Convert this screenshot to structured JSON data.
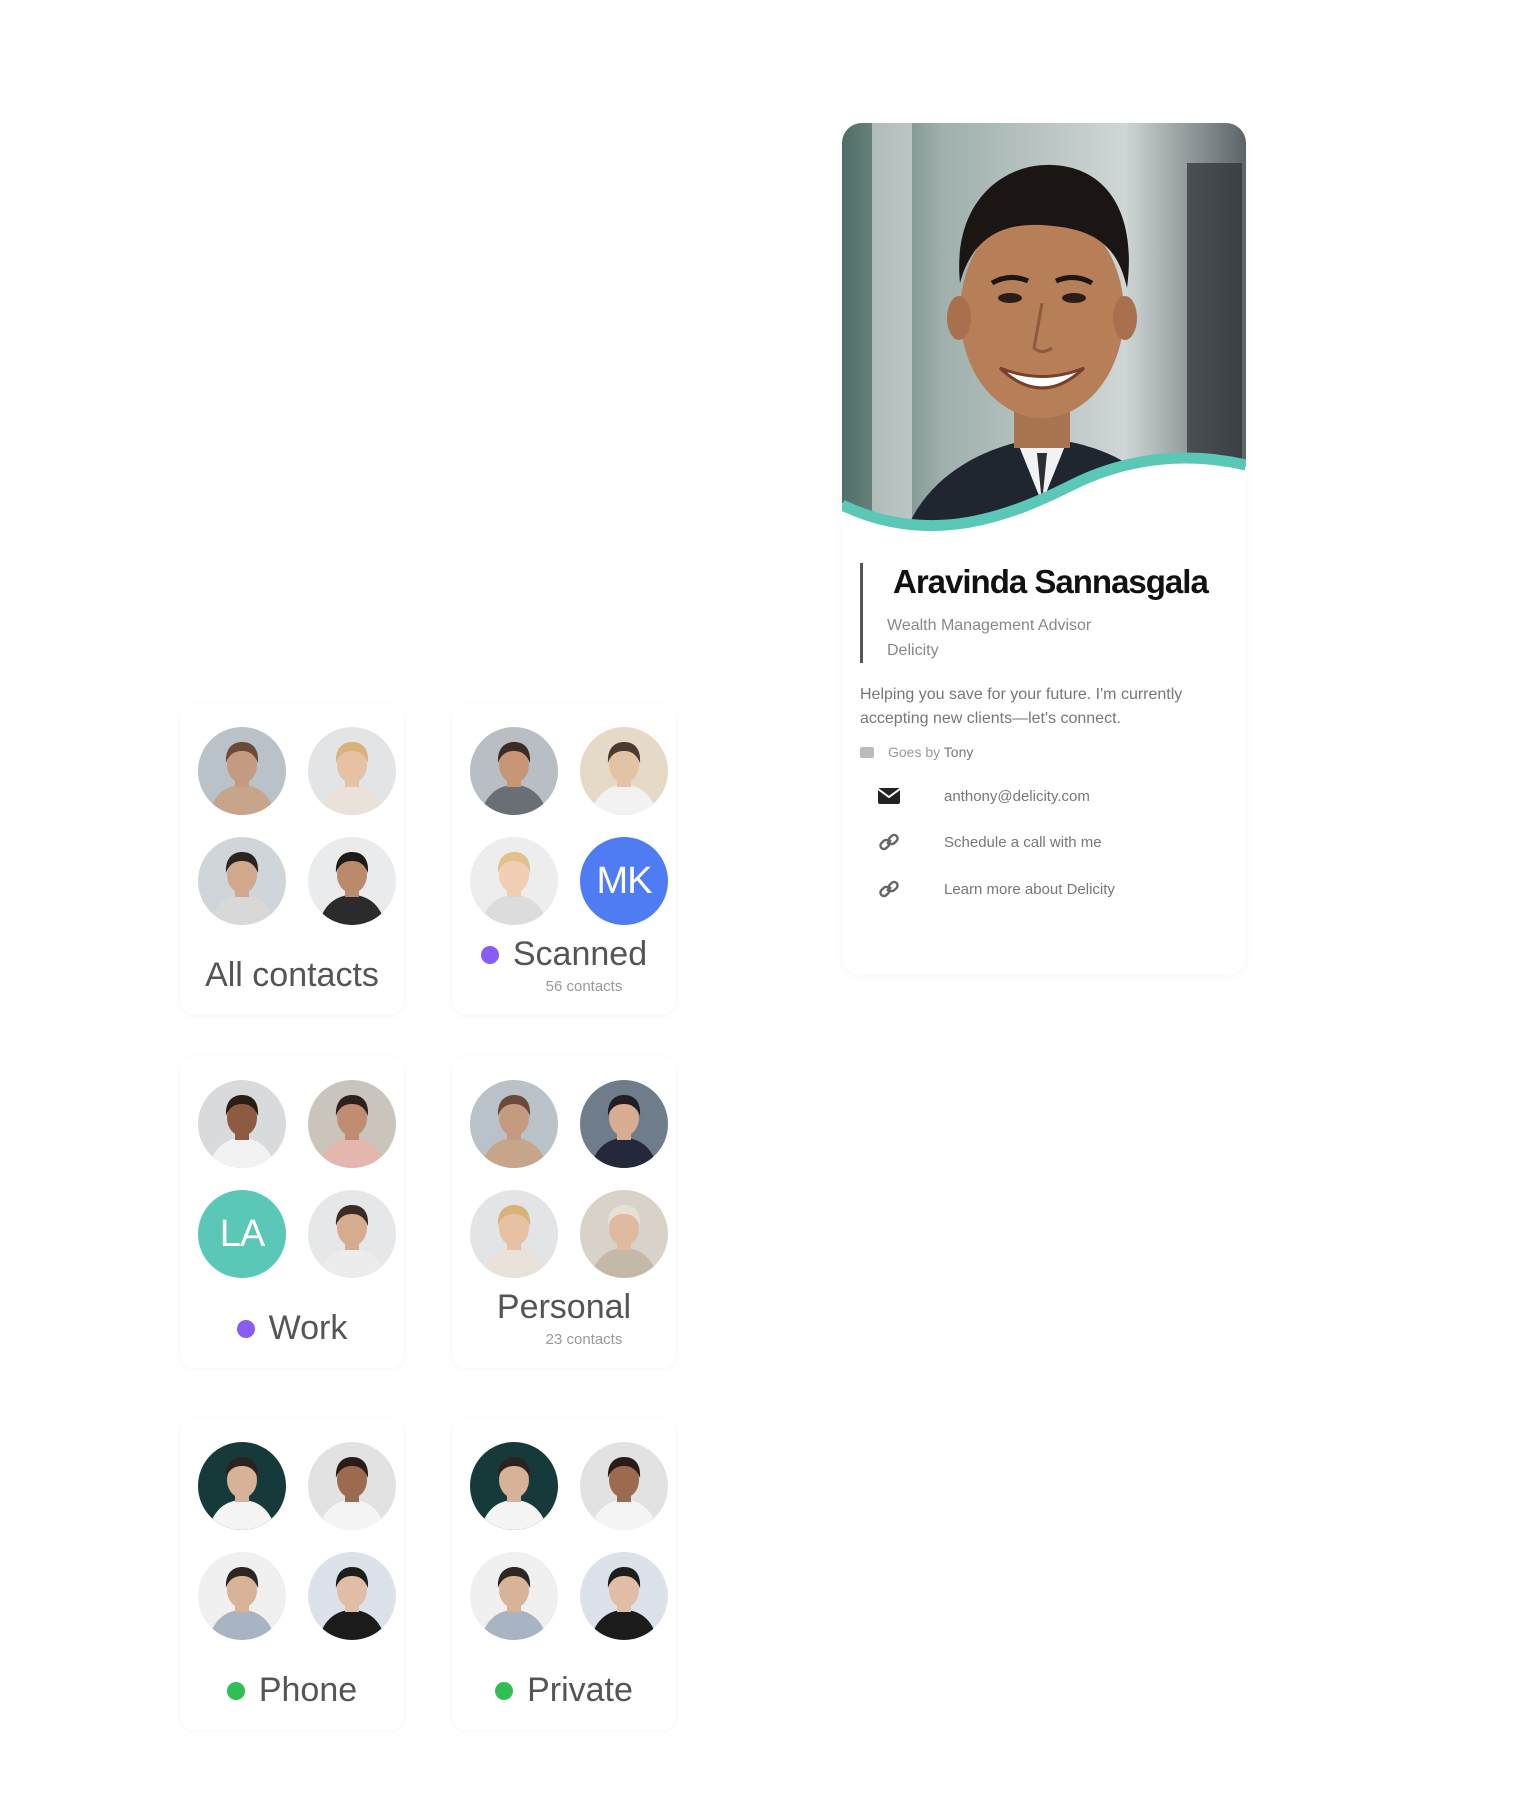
{
  "groups": [
    {
      "title": "All contacts",
      "count": "",
      "dot_color": "",
      "avatars": [
        {
          "type": "photo",
          "skin": "#c49a80",
          "hair": "#6b4a3a",
          "bg": "#b9c2c9",
          "shirt": "#c7a58a"
        },
        {
          "type": "photo",
          "skin": "#e6c1a4",
          "hair": "#d9b27a",
          "bg": "#e2e4e6",
          "shirt": "#e8e2da"
        },
        {
          "type": "photo",
          "skin": "#d2a88c",
          "hair": "#2a2521",
          "bg": "#cfd5d8",
          "shirt": "#d8d8d8"
        },
        {
          "type": "photo",
          "skin": "#b98b6c",
          "hair": "#1d1a18",
          "bg": "#e9ebed",
          "shirt": "#2b2b2b"
        }
      ]
    },
    {
      "title": "Scanned",
      "count": "56 contacts",
      "dot_color": "#8a5cf6",
      "avatars": [
        {
          "type": "photo",
          "skin": "#c79677",
          "hair": "#3b2c24",
          "bg": "#b8bec4",
          "shirt": "#6a6f76"
        },
        {
          "type": "photo",
          "skin": "#e4c2a6",
          "hair": "#4a3a30",
          "bg": "#e5d9c8",
          "shirt": "#f2f2f2"
        },
        {
          "type": "photo",
          "skin": "#f0cfb5",
          "hair": "#e2c18d",
          "bg": "#ededed",
          "shirt": "#dcdcdc"
        },
        {
          "type": "initials",
          "text": "MK",
          "color": "#4f7cf2"
        }
      ]
    },
    {
      "title": "Work",
      "count": "",
      "dot_color": "#8a5cf6",
      "avatars": [
        {
          "type": "photo",
          "skin": "#8c5b42",
          "hair": "#2b1c15",
          "bg": "#d8dadc",
          "shirt": "#f2f2f2"
        },
        {
          "type": "photo",
          "skin": "#c08d72",
          "hair": "#2c211c",
          "bg": "#c9c4bc",
          "shirt": "#e5b6ad"
        },
        {
          "type": "initials",
          "text": "LA",
          "color": "#5ac7b7"
        },
        {
          "type": "photo",
          "skin": "#d7ab8e",
          "hair": "#3a2d25",
          "bg": "#e6e7e8",
          "shirt": "#ececec"
        }
      ]
    },
    {
      "title": "Personal",
      "count": "23 contacts",
      "dot_color": "",
      "avatars": [
        {
          "type": "photo",
          "skin": "#c49a80",
          "hair": "#6b4a3a",
          "bg": "#b9c2c9",
          "shirt": "#c7a58a"
        },
        {
          "type": "photo",
          "skin": "#d6ad91",
          "hair": "#1f1f24",
          "bg": "#6f7d8a",
          "shirt": "#23283a"
        },
        {
          "type": "photo",
          "skin": "#e6c1a4",
          "hair": "#d9b27a",
          "bg": "#e2e4e6",
          "shirt": "#e8e2da"
        },
        {
          "type": "photo",
          "skin": "#dfb9a0",
          "hair": "#e6e0d6",
          "bg": "#d8d2c8",
          "shirt": "#c4b8a8"
        }
      ]
    },
    {
      "title": "Phone",
      "count": "",
      "dot_color": "#2fbf55",
      "avatars": [
        {
          "type": "photo",
          "skin": "#d8b298",
          "hair": "#2a2320",
          "bg": "#163a3a",
          "shirt": "#f4f4f4"
        },
        {
          "type": "photo",
          "skin": "#9c6a4f",
          "hair": "#2a1d17",
          "bg": "#e2e2e2",
          "shirt": "#f4f4f4"
        },
        {
          "type": "photo",
          "skin": "#d9b397",
          "hair": "#2d2622",
          "bg": "#f0f0f0",
          "shirt": "#a9b4c2"
        },
        {
          "type": "photo",
          "skin": "#e0bda4",
          "hair": "#1d1d1d",
          "bg": "#dde2ea",
          "shirt": "#1c1c1c"
        }
      ]
    },
    {
      "title": "Private",
      "count": "",
      "dot_color": "#2fbf55",
      "avatars": [
        {
          "type": "photo",
          "skin": "#d8b298",
          "hair": "#2a2320",
          "bg": "#163a3a",
          "shirt": "#f4f4f4"
        },
        {
          "type": "photo",
          "skin": "#9c6a4f",
          "hair": "#2a1d17",
          "bg": "#e2e2e2",
          "shirt": "#f4f4f4"
        },
        {
          "type": "photo",
          "skin": "#d9b397",
          "hair": "#2d2622",
          "bg": "#f0f0f0",
          "shirt": "#a9b4c2"
        },
        {
          "type": "photo",
          "skin": "#e0bda4",
          "hair": "#1d1d1d",
          "bg": "#dde2ea",
          "shirt": "#1c1c1c"
        }
      ]
    }
  ],
  "profile": {
    "name": "Aravinda Sannasgala",
    "title": "Wealth Management Advisor",
    "company": "Delicity",
    "bio": "Helping you save for your future. I'm currently accepting new clients—let's connect.",
    "goes_by_label": "Goes by",
    "goes_by_value": "Tony",
    "links": [
      {
        "icon": "mail-icon",
        "label": "anthony@delicity.com"
      },
      {
        "icon": "link-icon",
        "label": "Schedule a call with me"
      },
      {
        "icon": "link-icon",
        "label": "Learn more about Delicity"
      }
    ],
    "accent_color": "#5ac7b7"
  }
}
